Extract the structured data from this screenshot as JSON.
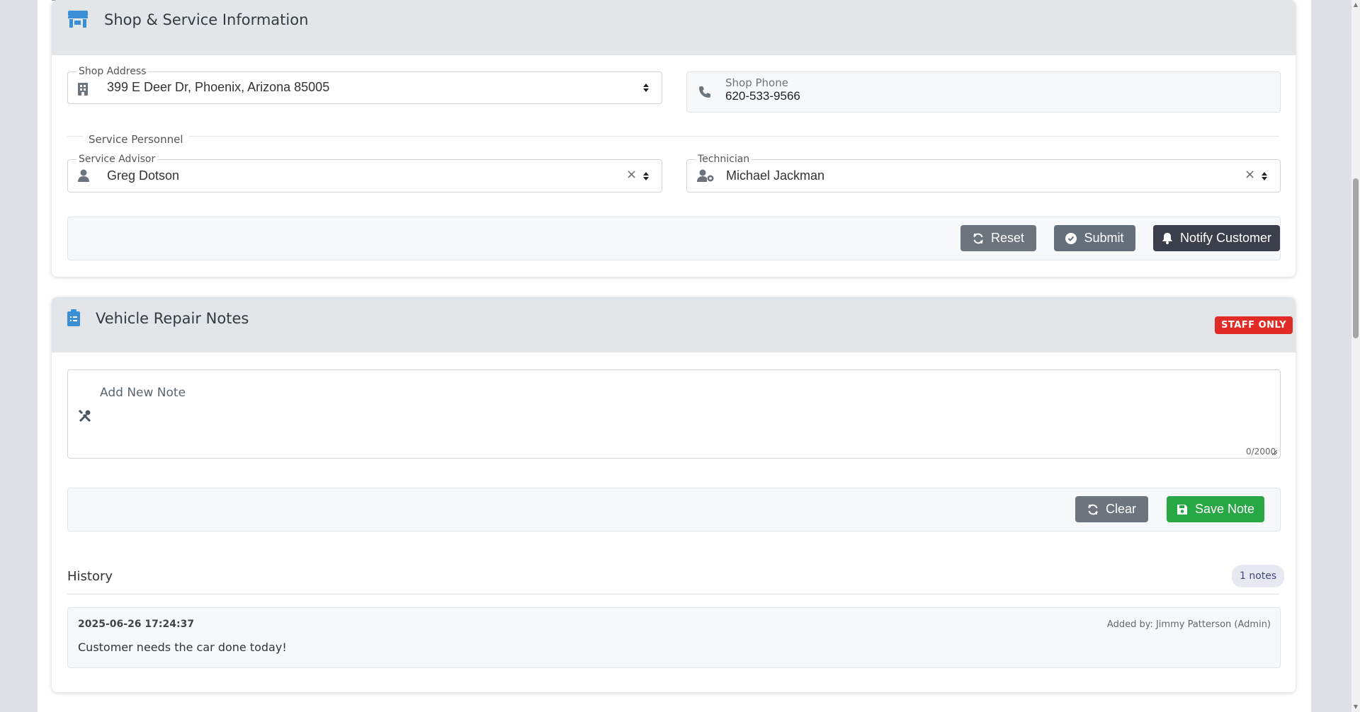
{
  "shop_section": {
    "title": "Shop & Service Information",
    "shop_address": {
      "label": "Shop Address",
      "value": "399 E Deer Dr, Phoenix, Arizona 85005"
    },
    "shop_phone": {
      "label": "Shop Phone",
      "value": "620-533-9566"
    },
    "personnel_legend": "Service Personnel",
    "service_advisor": {
      "label": "Service Advisor",
      "value": "Greg Dotson",
      "clear": "×"
    },
    "technician": {
      "label": "Technician",
      "value": "Michael Jackman",
      "clear": "×"
    },
    "buttons": {
      "reset": "Reset",
      "submit": "Submit",
      "notify": "Notify Customer"
    }
  },
  "notes_section": {
    "title": "Vehicle Repair Notes",
    "badge": "STAFF ONLY",
    "add_note_label": "Add New Note",
    "note_value": "",
    "char_count": "0/2000",
    "buttons": {
      "clear": "Clear",
      "save": "Save Note"
    },
    "history": {
      "title": "History",
      "count_badge": "1 notes",
      "items": [
        {
          "date": "2025-06-26 17:24:37",
          "added_by": "Added by: Jimmy Patterson (Admin)",
          "text": "Customer needs the car done today!"
        }
      ]
    }
  },
  "colors": {
    "accent_blue": "#3a8fd6",
    "staff_badge": "#e02b27",
    "save_green": "#28a745",
    "notify_dark": "#3a3f4b"
  },
  "icons": {
    "shop": "store-icon",
    "building": "building-icon",
    "phone": "phone-icon",
    "advisor": "user-icon",
    "technician": "user-gear-icon",
    "notes": "clipboard-icon",
    "note_tool": "tools-icon",
    "reset": "refresh-icon",
    "submit": "check-circle-icon",
    "notify": "bell-icon",
    "clear": "refresh-icon",
    "save": "save-icon"
  }
}
